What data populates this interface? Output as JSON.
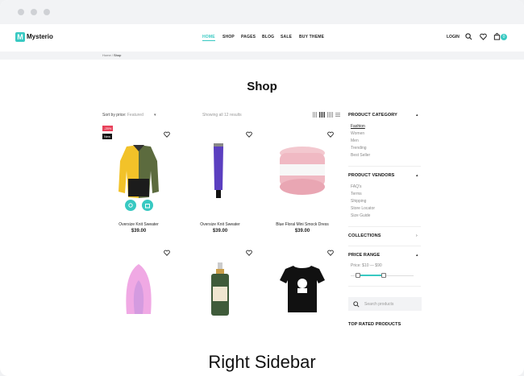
{
  "header": {
    "logo_letter": "M",
    "brand": "Mysterio",
    "nav": [
      "HOME",
      "SHOP",
      "PAGES",
      "BLOG",
      "SALE",
      "BUY THEME"
    ],
    "login": "LOGIN",
    "cart_count": "0",
    "accent": "#38c9c2"
  },
  "breadcrumb": {
    "home": "Home",
    "sep": " / ",
    "current": "Shop"
  },
  "page_title": "Shop",
  "toolbar": {
    "sort_label": "Sort by price:",
    "sort_value": "Featured",
    "showing": "Showing all 12 results"
  },
  "products": [
    {
      "name": "Oversize Knit Sweater",
      "price": "$39.00",
      "badges": [
        "-25%",
        "New"
      ],
      "icon": "jacket"
    },
    {
      "name": "Oversize Knit Sweater",
      "price": "$39.00",
      "icon": "tube"
    },
    {
      "name": "Blue Floral Mini Smock Dress",
      "price": "$39.00",
      "icon": "pink-case"
    },
    {
      "name": "",
      "price": "",
      "icon": "pink-sponge"
    },
    {
      "name": "",
      "price": "",
      "icon": "green-bottle"
    },
    {
      "name": "",
      "price": "",
      "icon": "black-tshirt"
    }
  ],
  "sidebar": {
    "category_title": "PRODUCT CATEGORY",
    "categories": [
      "Fashion",
      "Women",
      "Men",
      "Trending",
      "Best Seller"
    ],
    "vendors_title": "PRODUCT VENDORS",
    "vendors": [
      "FAQ's",
      "Terms",
      "Shipping",
      "Store Locator",
      "Size Guide"
    ],
    "collections_title": "COLLECTIONS",
    "price_title": "PRICE RANGE",
    "price_label": "Price: $10 — $90",
    "price_range": [
      10,
      90
    ],
    "search_placeholder": "Search products",
    "top_rated_title": "TOP RATED PRODUCTS"
  },
  "caption": "Right Sidebar"
}
